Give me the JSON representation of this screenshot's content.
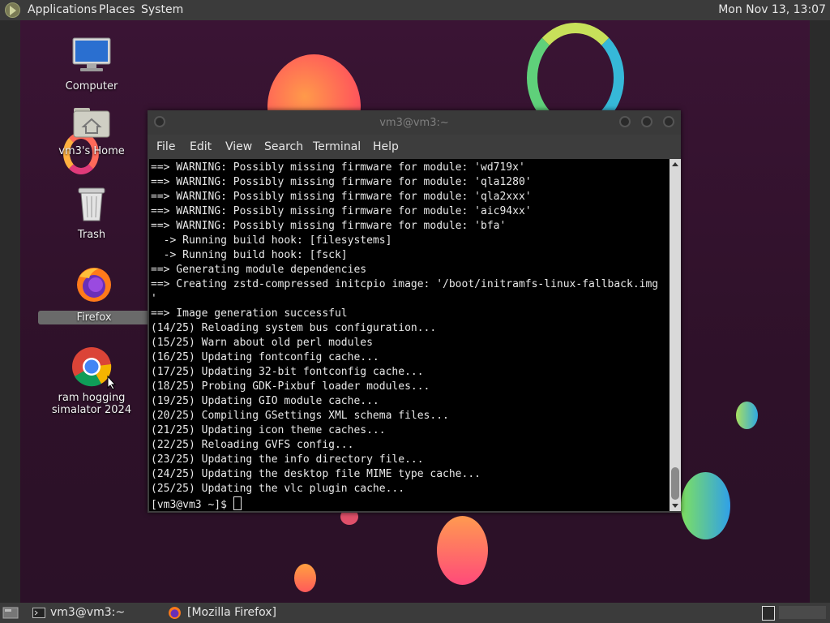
{
  "top_panel": {
    "menus": [
      "Applications",
      "Places",
      "System"
    ],
    "clock": "Mon Nov 13, 13:07"
  },
  "desktop_icons": [
    {
      "label": "Computer",
      "icon": "computer-icon"
    },
    {
      "label": "vm3's Home",
      "icon": "home-folder-icon"
    },
    {
      "label": "Trash",
      "icon": "trash-icon"
    },
    {
      "label": "Firefox",
      "icon": "firefox-icon"
    },
    {
      "label": "ram hogging\nsimalator 2024",
      "icon": "chrome-icon"
    }
  ],
  "window": {
    "title": "vm3@vm3:~",
    "menu": [
      "File",
      "Edit",
      "View",
      "Search",
      "Terminal",
      "Help"
    ]
  },
  "terminal": {
    "lines": [
      "==> WARNING: Possibly missing firmware for module: 'wd719x'",
      "==> WARNING: Possibly missing firmware for module: 'qla1280'",
      "==> WARNING: Possibly missing firmware for module: 'qla2xxx'",
      "==> WARNING: Possibly missing firmware for module: 'aic94xx'",
      "==> WARNING: Possibly missing firmware for module: 'bfa'",
      "  -> Running build hook: [filesystems]",
      "  -> Running build hook: [fsck]",
      "==> Generating module dependencies",
      "==> Creating zstd-compressed initcpio image: '/boot/initramfs-linux-fallback.img",
      "'",
      "==> Image generation successful",
      "(14/25) Reloading system bus configuration...",
      "(15/25) Warn about old perl modules",
      "(16/25) Updating fontconfig cache...",
      "(17/25) Updating 32-bit fontconfig cache...",
      "(18/25) Probing GDK-Pixbuf loader modules...",
      "(19/25) Updating GIO module cache...",
      "(20/25) Compiling GSettings XML schema files...",
      "(21/25) Updating icon theme caches...",
      "(22/25) Reloading GVFS config...",
      "(23/25) Updating the info directory file...",
      "(24/25) Updating the desktop file MIME type cache...",
      "(25/25) Updating the vlc plugin cache..."
    ],
    "prompt": "[vm3@vm3 ~]$ "
  },
  "taskbar": {
    "items": [
      "vm3@vm3:~",
      "[Mozilla Firefox]"
    ]
  },
  "colors": {
    "panel": "#3b3b3b",
    "wallpaper": "#3a1434",
    "terminal_bg": "#000000",
    "terminal_fg": "#e8e8e8"
  }
}
